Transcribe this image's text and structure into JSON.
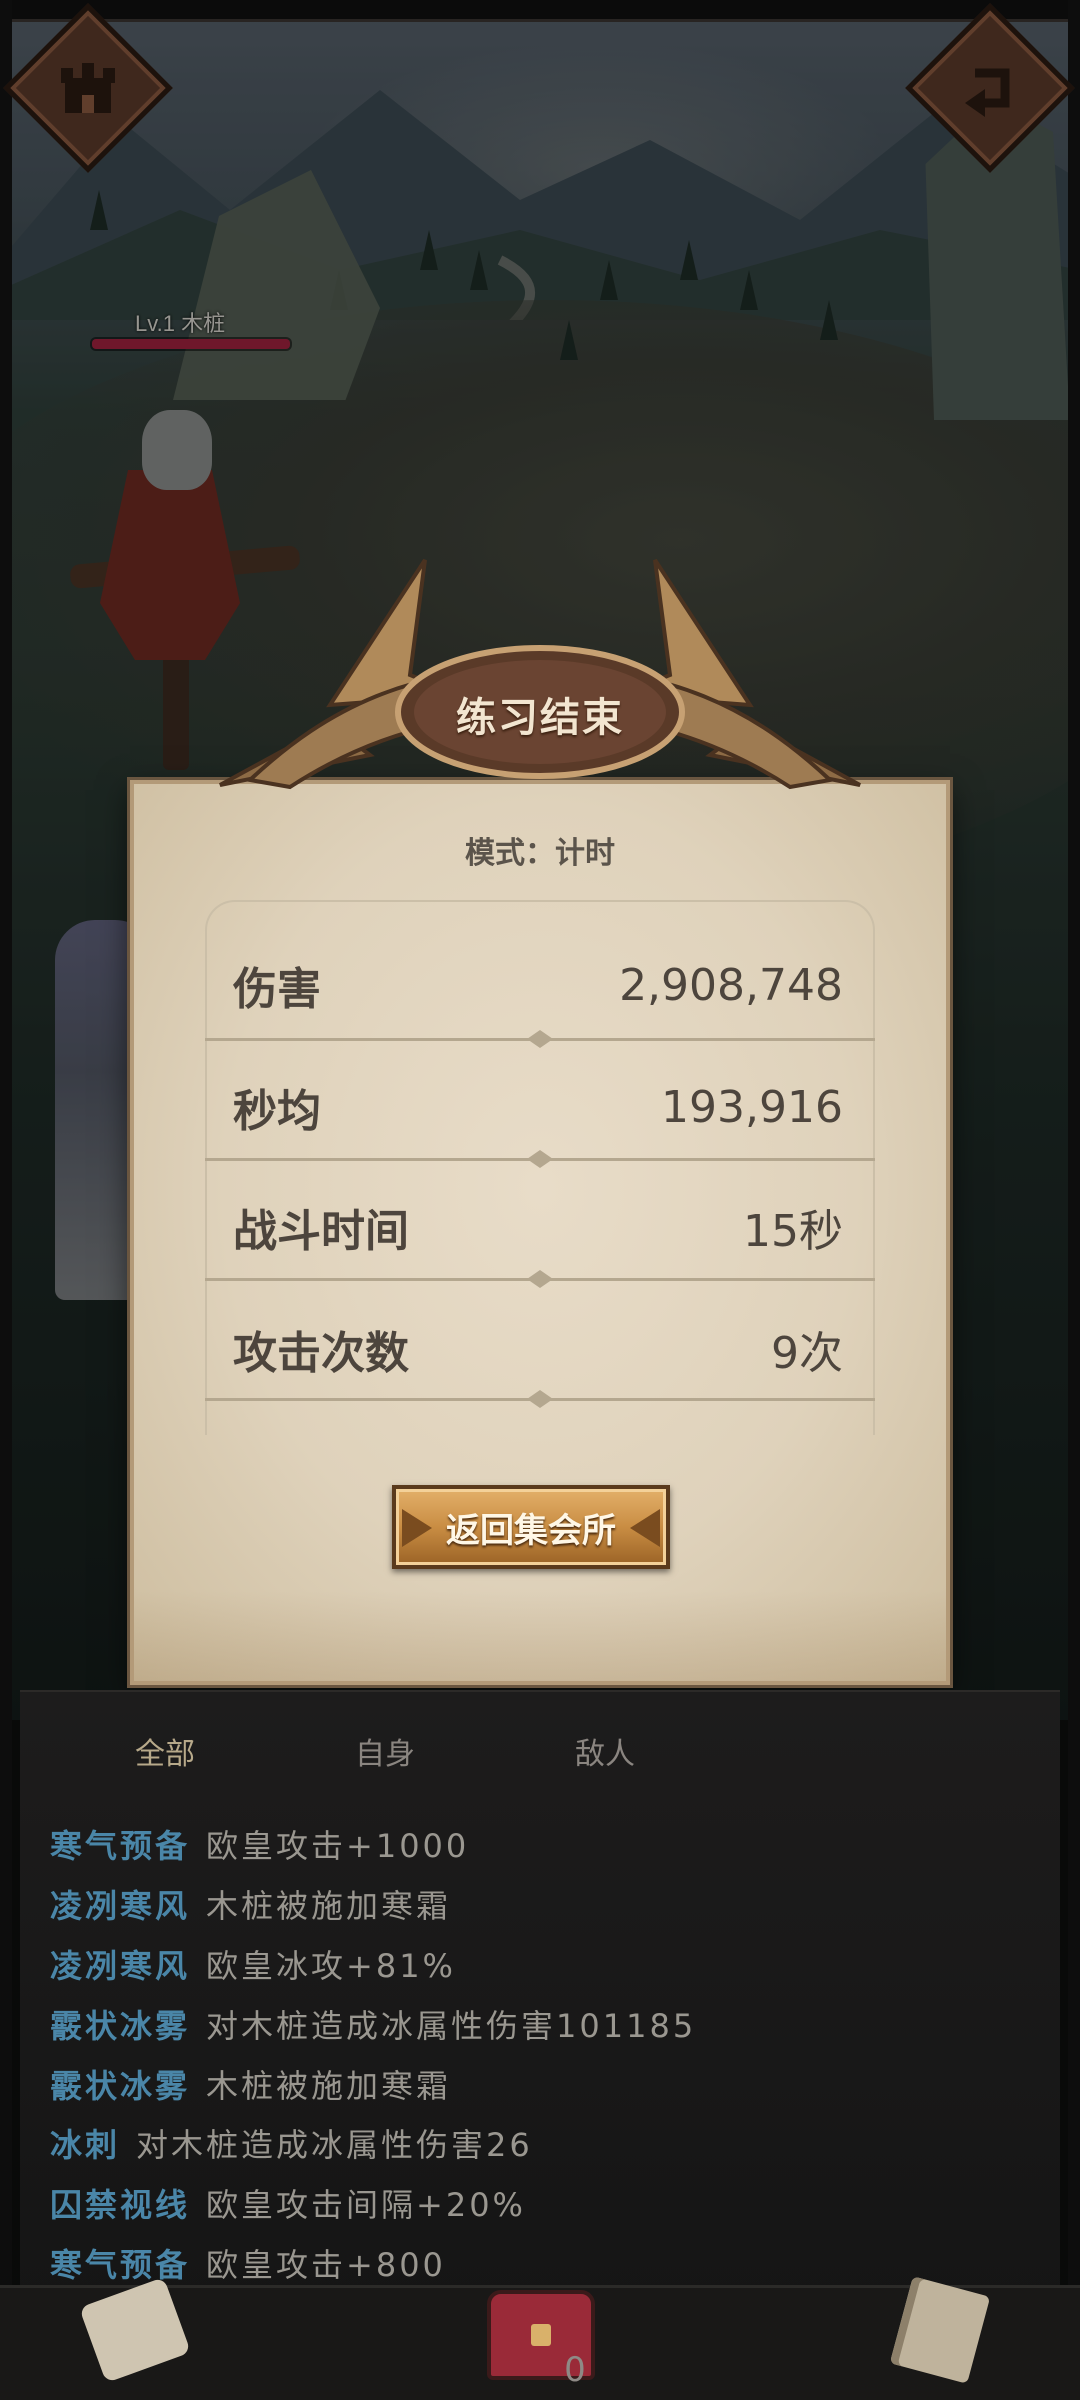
{
  "enemy": {
    "label": "Lv.1  木桩",
    "hp_fraction": 1.0
  },
  "modal": {
    "title": "练习结束",
    "mode": "模式：计时",
    "stats": [
      {
        "label": "伤害",
        "value": "2,908,748"
      },
      {
        "label": "秒均",
        "value": "193,916"
      },
      {
        "label": "战斗时间",
        "value": "15秒"
      },
      {
        "label": "攻击次数",
        "value": "9次"
      }
    ],
    "return_label": "返回集会所"
  },
  "log": {
    "tabs": [
      {
        "label": "全部",
        "active": true
      },
      {
        "label": "自身",
        "active": false
      },
      {
        "label": "敌人",
        "active": false
      }
    ],
    "entries": [
      {
        "source": "寒气预备",
        "text": "欧皇攻击+1000"
      },
      {
        "source": "凌冽寒风",
        "text": "木桩被施加寒霜"
      },
      {
        "source": "凌冽寒风",
        "text": "欧皇冰攻+81%"
      },
      {
        "source": "霰状冰雾",
        "text": "对木桩造成冰属性伤害101185"
      },
      {
        "source": "霰状冰雾",
        "text": "木桩被施加寒霜"
      },
      {
        "source": "冰刺",
        "text": "对木桩造成冰属性伤害26"
      },
      {
        "source": "囚禁视线",
        "text": "欧皇攻击间隔+20%"
      },
      {
        "source": "寒气预备",
        "text": "欧皇攻击+800"
      }
    ]
  },
  "bottom_bar": {
    "chest_count": "0"
  },
  "colors": {
    "log_source": "#4a86a8",
    "button_gold": "#c98d43",
    "hp_bar": "#a0223e"
  }
}
